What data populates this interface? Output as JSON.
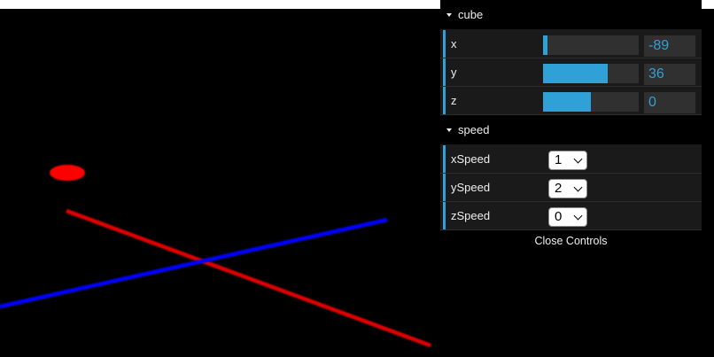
{
  "scene": {
    "axis_colors": {
      "x": "#e00000",
      "y": "#00c000",
      "z": "#0000ff"
    },
    "cube_color": "#ff0000"
  },
  "gui": {
    "accent_color": "#2fa1d6",
    "folders": [
      {
        "title": "cube",
        "controls": [
          {
            "label": "x",
            "value": "-89",
            "fill_fraction": 0.05
          },
          {
            "label": "y",
            "value": "36",
            "fill_fraction": 0.68
          },
          {
            "label": "z",
            "value": "0",
            "fill_fraction": 0.5
          }
        ]
      },
      {
        "title": "speed",
        "controls": [
          {
            "label": "xSpeed",
            "selected": "1"
          },
          {
            "label": "ySpeed",
            "selected": "2"
          },
          {
            "label": "zSpeed",
            "selected": "0"
          }
        ]
      }
    ],
    "close_label": "Close Controls"
  }
}
